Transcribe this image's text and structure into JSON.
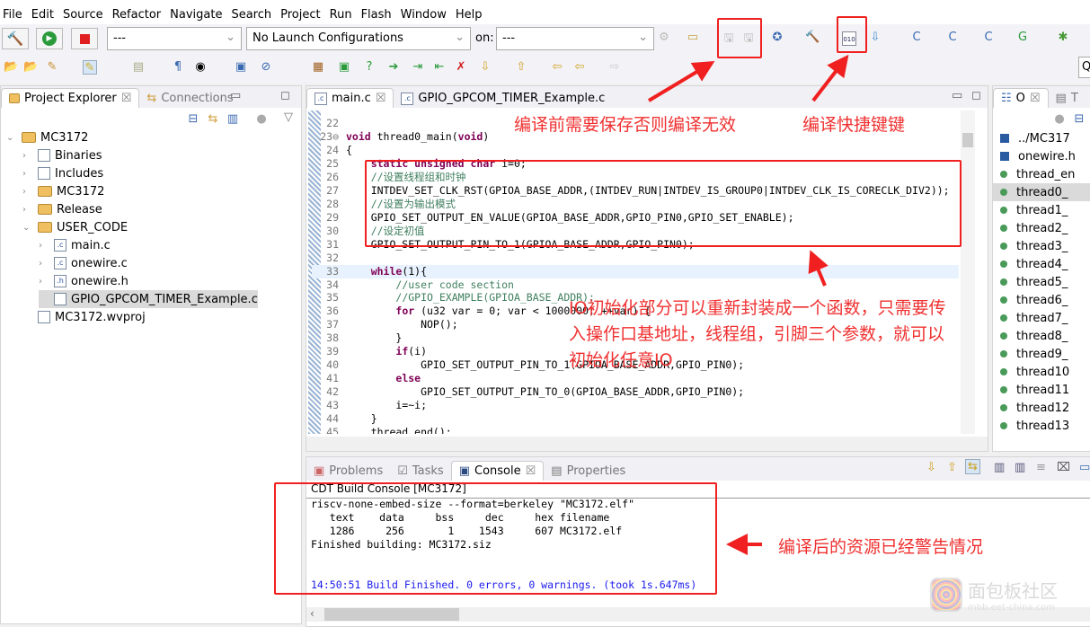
{
  "menu": [
    "File",
    "Edit",
    "Source",
    "Refactor",
    "Navigate",
    "Search",
    "Project",
    "Run",
    "Flash",
    "Window",
    "Help"
  ],
  "toolbar": {
    "build_config": "---",
    "launch_config": "No Launch Configurations",
    "on_label": "on:",
    "target": "---",
    "search": "Q"
  },
  "left_panel": {
    "tabs": [
      "Project Explorer",
      "Connections"
    ],
    "tree": [
      {
        "label": "MC3172",
        "depth": 0,
        "twisty": "open",
        "icon": "project-icon"
      },
      {
        "label": "Binaries",
        "depth": 1,
        "twisty": "closed",
        "icon": "binaries-icon"
      },
      {
        "label": "Includes",
        "depth": 1,
        "twisty": "closed",
        "icon": "includes-icon"
      },
      {
        "label": "MC3172",
        "depth": 1,
        "twisty": "closed",
        "icon": "folder-icon"
      },
      {
        "label": "Release",
        "depth": 1,
        "twisty": "closed",
        "icon": "folder-icon"
      },
      {
        "label": "USER_CODE",
        "depth": 1,
        "twisty": "open",
        "icon": "folder-icon"
      },
      {
        "label": "main.c",
        "depth": 2,
        "twisty": "closed",
        "icon": "c-file-icon"
      },
      {
        "label": "onewire.c",
        "depth": 2,
        "twisty": "closed",
        "icon": "c-file-icon"
      },
      {
        "label": "onewire.h",
        "depth": 2,
        "twisty": "closed",
        "icon": "h-file-icon"
      },
      {
        "label": "GPIO_GPCOM_TIMER_Example.c",
        "depth": 2,
        "twisty": "none",
        "icon": "excluded-file-icon",
        "selected": true
      },
      {
        "label": "MC3172.wvproj",
        "depth": 1,
        "twisty": "none",
        "icon": "text-file-icon"
      }
    ]
  },
  "editor": {
    "tabs": [
      "main.c",
      "GPIO_GPCOM_TIMER_Example.c"
    ],
    "lines": [
      {
        "n": "22",
        "segs": [
          [
            "",
            ""
          ]
        ]
      },
      {
        "n": "23⊖",
        "segs": [
          [
            "kw",
            "void"
          ],
          [
            "",
            " thread0_main("
          ],
          [
            "kw",
            "void"
          ],
          [
            "",
            ")"
          ]
        ]
      },
      {
        "n": "24",
        "segs": [
          [
            "",
            "{"
          ]
        ]
      },
      {
        "n": "25",
        "segs": [
          [
            "",
            "    "
          ],
          [
            "kw",
            "static unsigned char"
          ],
          [
            "",
            " i=0;"
          ]
        ]
      },
      {
        "n": "26",
        "segs": [
          [
            "",
            "    "
          ],
          [
            "cm",
            "//设置线程组和时钟"
          ]
        ]
      },
      {
        "n": "27",
        "segs": [
          [
            "",
            "    INTDEV_SET_CLK_RST(GPIOA_BASE_ADDR,(INTDEV_RUN|INTDEV_IS_GROUP0|INTDEV_CLK_IS_CORECLK_DIV2));"
          ]
        ]
      },
      {
        "n": "28",
        "segs": [
          [
            "",
            "    "
          ],
          [
            "cm",
            "//设置为输出模式"
          ]
        ]
      },
      {
        "n": "29",
        "segs": [
          [
            "",
            "    GPIO_SET_OUTPUT_EN_VALUE(GPIOA_BASE_ADDR,GPIO_PIN0,GPIO_SET_ENABLE);"
          ]
        ]
      },
      {
        "n": "30",
        "segs": [
          [
            "",
            "    "
          ],
          [
            "cm",
            "//设定初值"
          ]
        ]
      },
      {
        "n": "31",
        "segs": [
          [
            "",
            "    GPIO_SET_OUTPUT_PIN_TO_1(GPIOA_BASE_ADDR,GPIO_PIN0);"
          ]
        ]
      },
      {
        "n": "32",
        "segs": [
          [
            "",
            ""
          ]
        ]
      },
      {
        "n": "33",
        "segs": [
          [
            "",
            "    "
          ],
          [
            "kw",
            "while"
          ],
          [
            "",
            "(1){"
          ]
        ],
        "current": true
      },
      {
        "n": "34",
        "segs": [
          [
            "",
            "        "
          ],
          [
            "cm",
            "//user code section"
          ]
        ]
      },
      {
        "n": "35",
        "segs": [
          [
            "",
            "        "
          ],
          [
            "cm",
            "//GPIO_EXAMPLE(GPIOA_BASE_ADDR);"
          ]
        ]
      },
      {
        "n": "36",
        "segs": [
          [
            "",
            "        "
          ],
          [
            "kw",
            "for"
          ],
          [
            "",
            " (u32 var = 0; var < 1000000; ++var) {"
          ]
        ]
      },
      {
        "n": "37",
        "segs": [
          [
            "",
            "            NOP();"
          ]
        ]
      },
      {
        "n": "38",
        "segs": [
          [
            "",
            "        }"
          ]
        ]
      },
      {
        "n": "39",
        "segs": [
          [
            "",
            "        "
          ],
          [
            "kw",
            "if"
          ],
          [
            "",
            "(i)"
          ]
        ]
      },
      {
        "n": "40",
        "segs": [
          [
            "",
            "            GPIO_SET_OUTPUT_PIN_TO_1(GPIOA_BASE_ADDR,GPIO_PIN0);"
          ]
        ]
      },
      {
        "n": "41",
        "segs": [
          [
            "",
            "        "
          ],
          [
            "kw",
            "else"
          ]
        ]
      },
      {
        "n": "42",
        "segs": [
          [
            "",
            "            GPIO_SET_OUTPUT_PIN_TO_0(GPIOA_BASE_ADDR,GPIO_PIN0);"
          ]
        ]
      },
      {
        "n": "43",
        "segs": [
          [
            "",
            "        i=~i;"
          ]
        ]
      },
      {
        "n": "44",
        "segs": [
          [
            "",
            "    }"
          ]
        ]
      },
      {
        "n": "45",
        "segs": [
          [
            "",
            "    thread_end();"
          ]
        ]
      }
    ]
  },
  "outline": {
    "tabs": [
      "O",
      "T"
    ],
    "items": [
      "../MC317",
      "onewire.h",
      "thread_en",
      "thread0_",
      "thread1_",
      "thread2_",
      "thread3_",
      "thread4_",
      "thread5_",
      "thread6_",
      "thread7_",
      "thread8_",
      "thread9_",
      "thread10",
      "thread11",
      "thread12",
      "thread13"
    ],
    "selected_index": 3
  },
  "bottom": {
    "tabs": [
      "Problems",
      "Tasks",
      "Console",
      "Properties"
    ],
    "active": "Console",
    "console_title": "CDT Build Console [MC3172]",
    "console_lines": [
      "riscv-none-embed-size --format=berkeley \"MC3172.elf\"",
      "   text    data     bss     dec     hex filename",
      "   1286     256       1    1543     607 MC3172.elf",
      "Finished building: MC3172.siz"
    ],
    "console_status": "14:50:51 Build Finished. 0 errors, 0 warnings. (took 1s.647ms)",
    "status_color": "#1a1aee"
  },
  "annotations": {
    "save_note": "编译前需要保存否则编译无效",
    "build_note": "编译快捷键键",
    "io_note": [
      "IO初始化部分可以重新封装成一个函数，只需要传",
      "入操作口基地址，线程组，引脚三个参数，就可以",
      "初始化任意IO"
    ],
    "console_note": "编译后的资源已经警告情况",
    "color": "#f02020"
  },
  "watermark": {
    "name": "面包板社区",
    "url": "mbb.eet-china.com"
  }
}
